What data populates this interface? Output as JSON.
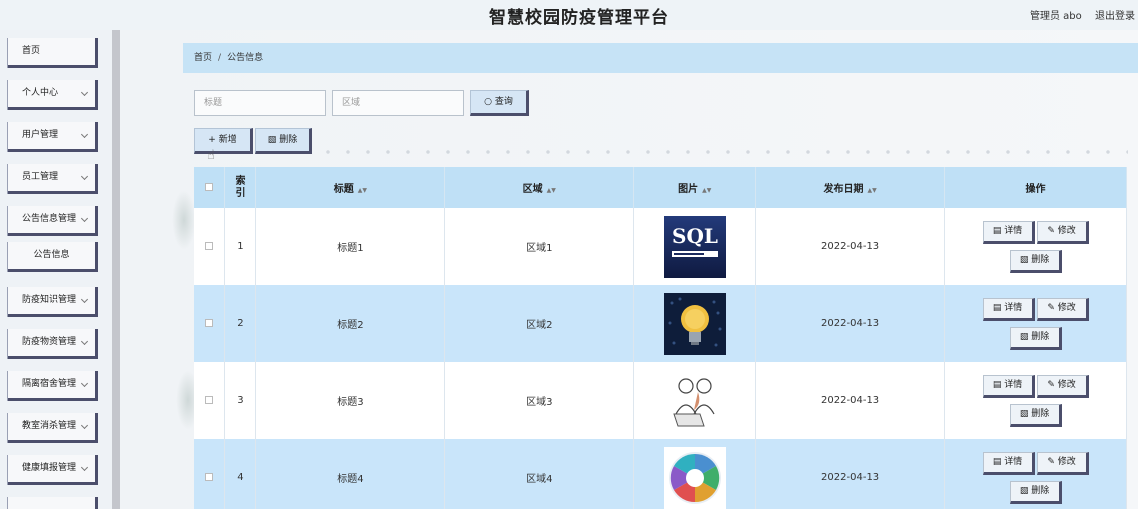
{
  "header": {
    "title": "智慧校园防疫管理平台",
    "user": "管理员 abo",
    "logout": "退出登录"
  },
  "sidebar": {
    "items": [
      {
        "label": "首页",
        "has_chevron": false
      },
      {
        "label": "个人中心",
        "has_chevron": true
      },
      {
        "label": "用户管理",
        "has_chevron": true
      },
      {
        "label": "员工管理",
        "has_chevron": true
      },
      {
        "label": "公告信息管理",
        "has_chevron": true
      },
      {
        "label": "公告信息",
        "has_chevron": false
      },
      {
        "label": "防疫知识管理",
        "has_chevron": true
      },
      {
        "label": "防疫物资管理",
        "has_chevron": true
      },
      {
        "label": "隔离宿舍管理",
        "has_chevron": true
      },
      {
        "label": "教室消杀管理",
        "has_chevron": true
      },
      {
        "label": "健康填报管理",
        "has_chevron": true
      }
    ]
  },
  "breadcrumb": {
    "home": "首页",
    "separator": "/",
    "current": "公告信息"
  },
  "search": {
    "title_placeholder": "标题",
    "area_placeholder": "区域",
    "query_label": "查询"
  },
  "toolbar": {
    "add_label": "新增",
    "delete_label": "删除"
  },
  "table": {
    "headers": {
      "index": "索引",
      "title": "标题",
      "area": "区域",
      "image": "图片",
      "date": "发布日期",
      "actions": "操作"
    },
    "rows": [
      {
        "index": "1",
        "title": "标题1",
        "area": "区域1",
        "image": "sql-functions-thumbnail",
        "date": "2022-04-13"
      },
      {
        "index": "2",
        "title": "标题2",
        "area": "区域2",
        "image": "lightbulb-thumbnail",
        "date": "2022-04-13"
      },
      {
        "index": "3",
        "title": "标题3",
        "area": "区域3",
        "image": "people-laptop-thumbnail",
        "date": "2022-04-13"
      },
      {
        "index": "4",
        "title": "标题4",
        "area": "区域4",
        "image": "circular-diagram-thumbnail",
        "date": "2022-04-13"
      }
    ],
    "row_actions": {
      "detail": "详情",
      "edit": "修改",
      "delete": "删除"
    }
  },
  "colors": {
    "header_row": "#bfe0f6",
    "alt_row": "#c9e5fa",
    "breadcrumb_bg": "#c6e3f6",
    "button_shadow": "#4b4e6b"
  }
}
